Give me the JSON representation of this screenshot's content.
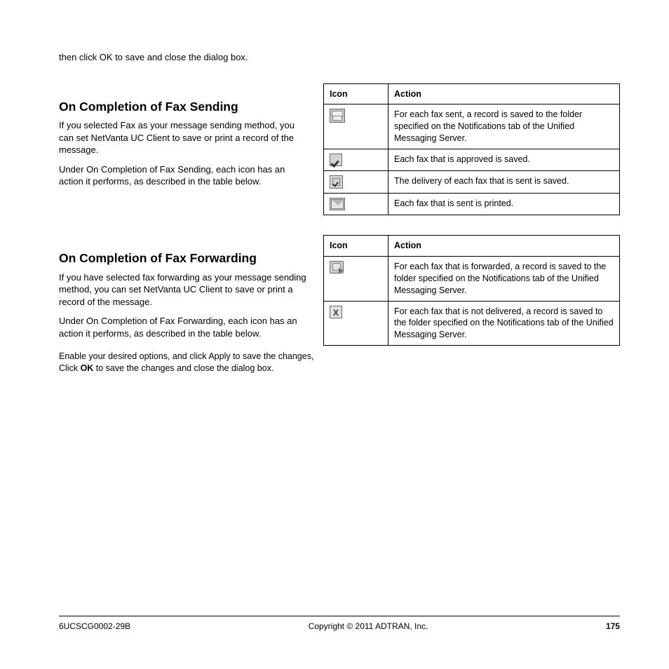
{
  "intro": "then click OK to save and close the dialog box.",
  "section1": {
    "heading": "On Completion of Fax Sending",
    "para1": "If you selected Fax as your message sending method, you can set NetVanta UC Client to save or print a record of the message.",
    "para2": "Under On Completion of Fax Sending, each icon has an action it performs, as described in the table below.",
    "table": {
      "headers": [
        "Icon",
        "Action"
      ],
      "rows": [
        {
          "iconName": "fax-machine-icon",
          "text": "For each fax sent, a record is saved to the folder specified on the Notifications tab of the Unified Messaging Server."
        },
        {
          "iconName": "approved-check-icon",
          "text": "Each fax that is approved is saved."
        },
        {
          "iconName": "sent-check-icon",
          "text": "The delivery of each fax that is sent is saved."
        },
        {
          "iconName": "print-envelope-icon",
          "text": "Each fax that is sent is printed."
        }
      ]
    }
  },
  "section2": {
    "heading": "On Completion of Fax Forwarding",
    "para1": "If you have selected fax forwarding as your message sending method, you can set NetVanta UC Client to save or print a record of the message.",
    "para2": "Under On Completion of Fax Forwarding, each icon has an action it performs, as described in the table below.",
    "table": {
      "headers": [
        "Icon",
        "Action"
      ],
      "rows": [
        {
          "iconName": "forward-printer-icon",
          "text": "For each fax that is forwarded, a record is saved to the folder specified on the Notifications tab of the Unified Messaging Server."
        },
        {
          "iconName": "not-delivered-x-icon",
          "text": "For each fax that is not delivered, a record is saved to the folder specified on the Notifications tab of the Unified Messaging Server."
        }
      ]
    }
  },
  "closing": {
    "line1": "Enable your desired options, and click Apply to save the changes,",
    "line2_pre": "Click ",
    "line2_btn": "OK",
    "line2_post": " to save the changes and close the dialog box."
  },
  "footer": {
    "code": "6UCSCG0002-29B",
    "copyright": "Copyright © 2011 ADTRAN, Inc.",
    "page": "175"
  }
}
